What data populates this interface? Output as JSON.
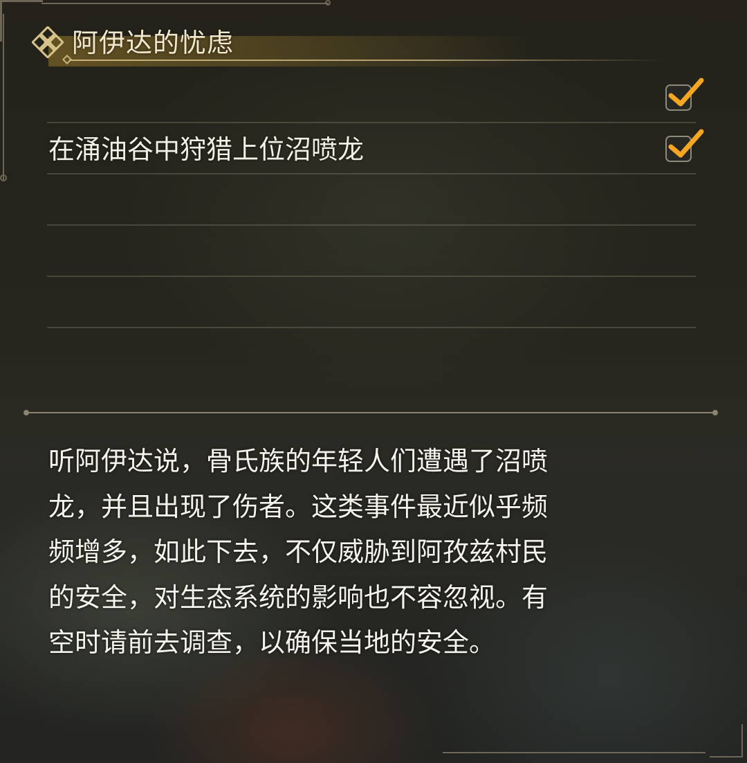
{
  "quest": {
    "title": "阿伊达的忧虑",
    "title_icon": "ornate-diamond-icon",
    "objectives": [
      {
        "text": "",
        "completed": true
      },
      {
        "text": "在涌油谷中狩猎上位沼喷龙",
        "completed": true
      },
      {
        "text": "",
        "completed": false
      },
      {
        "text": "",
        "completed": false
      },
      {
        "text": "",
        "completed": false
      },
      {
        "text": "",
        "completed": false
      }
    ],
    "description": "听阿伊达说，骨氏族的年轻人们遭遇了沼喷\n龙，并且出现了伤者。这类事件最近似乎频\n频增多，如此下去，不仅威胁到阿孜兹村民\n的安全，对生态系统的影响也不容忽视。有\n空时请前去调查，以确保当地的安全。"
  },
  "colors": {
    "title_text": "#f1e7cc",
    "accent_gold": "#c8b37a",
    "check_orange": "#f5a623",
    "body_text": "#f5f3ec"
  }
}
